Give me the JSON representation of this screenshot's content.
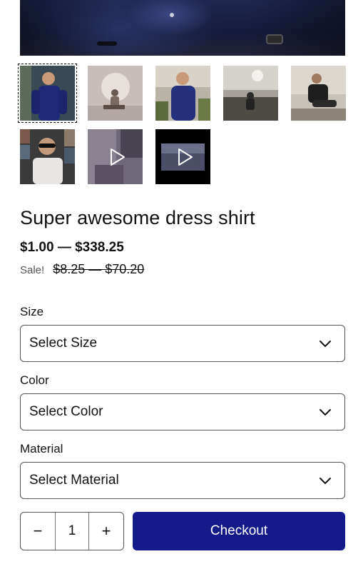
{
  "gallery": {
    "hero_alt_icon": "product-hero-photo",
    "thumbnails": [
      {
        "name": "thumb-1",
        "type": "image",
        "selected": true
      },
      {
        "name": "thumb-2",
        "type": "image",
        "selected": false
      },
      {
        "name": "thumb-3",
        "type": "image",
        "selected": false
      },
      {
        "name": "thumb-4",
        "type": "image",
        "selected": false
      },
      {
        "name": "thumb-5",
        "type": "image",
        "selected": false
      },
      {
        "name": "thumb-6",
        "type": "image",
        "selected": false
      },
      {
        "name": "thumb-7",
        "type": "video",
        "selected": false
      },
      {
        "name": "thumb-8",
        "type": "video",
        "selected": false
      }
    ]
  },
  "product": {
    "title": "Super awesome dress shirt",
    "price_range": "$1.00 — $338.25",
    "sale_label": "Sale!",
    "original_price_range": "$8.25 — $70.20"
  },
  "options": {
    "size": {
      "label": "Size",
      "value": "Select Size"
    },
    "color": {
      "label": "Color",
      "value": "Select Color"
    },
    "material": {
      "label": "Material",
      "value": "Select Material"
    }
  },
  "cart": {
    "decrement_label": "−",
    "quantity": "1",
    "increment_label": "+",
    "checkout_label": "Checkout"
  },
  "colors": {
    "accent": "#131b8a",
    "border": "#555555"
  }
}
